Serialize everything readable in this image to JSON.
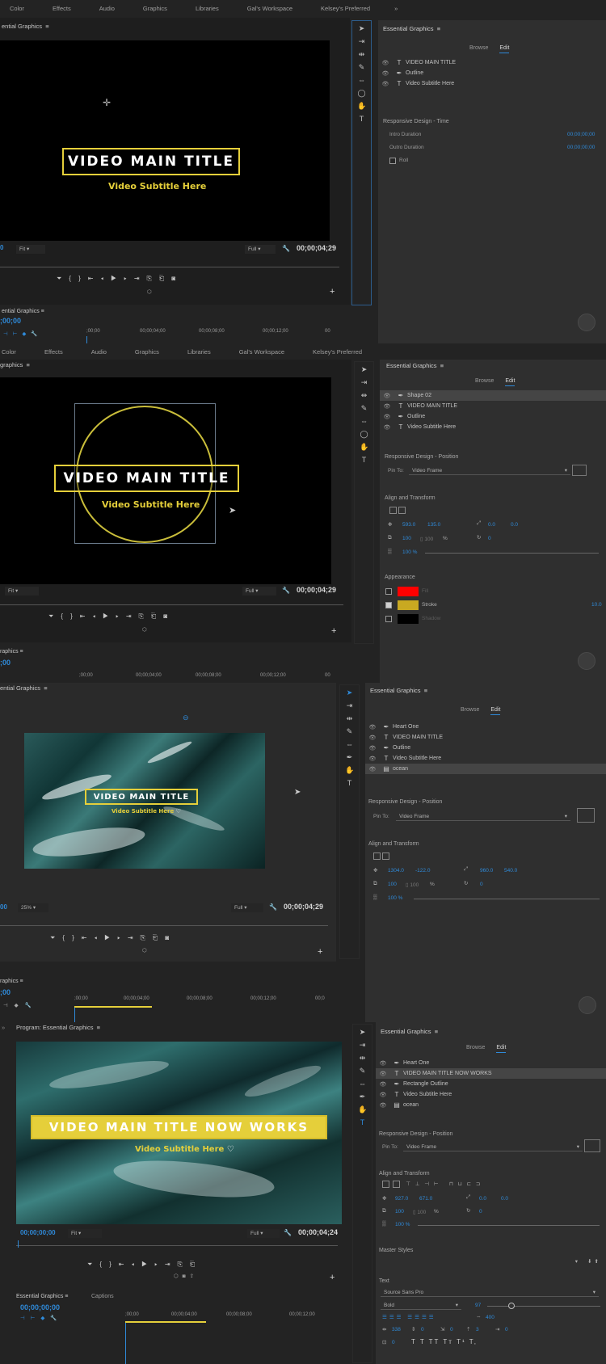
{
  "workspaces": [
    "Color",
    "Effects",
    "Audio",
    "Graphics",
    "Libraries",
    "Gal's Workspace",
    "Kelsey's Preferred"
  ],
  "overflow": "»",
  "s1": {
    "program_header": "ential Graphics",
    "title": "VIDEO MAIN TITLE",
    "subtitle": "Video Subtitle Here",
    "tc_left": "0",
    "fit": "Fit",
    "full": "Full",
    "timecode": "00;00;04;29",
    "tl_header": "ential Graphics",
    "tl_tc": ";00;00",
    "ruler": [
      ";00;00",
      "00;00;04;00",
      "00;00;08;00",
      "00;00;12;00",
      "00"
    ],
    "eg_title": "Essential Graphics",
    "browse": "Browse",
    "edit": "Edit",
    "layers": [
      "VIDEO MAIN TITLE",
      "Outline",
      "Video Subtitle Here"
    ],
    "rd_title": "Responsive Design - Time",
    "intro_label": "Intro Duration",
    "intro_val": "00;00;00;00",
    "outro_label": "Outro Duration",
    "outro_val": "00;00;00;00",
    "roll": "Roll"
  },
  "s2": {
    "program_header": "graphics",
    "title": "VIDEO MAIN TITLE",
    "subtitle": "Video Subtitle Here",
    "fit": "Fit",
    "full": "Full",
    "timecode": "00;00;04;29",
    "tl_header": "raphics",
    "tl_tc": ";00",
    "ruler": [
      ";00;00",
      "00;00;04;00",
      "00;00;08;00",
      "00;00;12;00",
      "00"
    ],
    "eg_title": "Essential Graphics",
    "browse": "Browse",
    "edit": "Edit",
    "layers": [
      "Shape 02",
      "VIDEO MAIN TITLE",
      "Outline",
      "Video Subtitle Here"
    ],
    "rd_title": "Responsive Design - Position",
    "pin_label": "Pin To:",
    "pin_val": "Video Frame",
    "at_title": "Align and Transform",
    "pos_x": "593.0",
    "pos_y": "135.0",
    "anchor_x": "0.0",
    "anchor_y": "0.0",
    "scale_a": "100",
    "scale_b": "100",
    "pct": "%",
    "rot": "0",
    "opacity": "100 %",
    "appearance": "Appearance",
    "fill": "Fill",
    "stroke": "Stroke",
    "stroke_val": "10.0",
    "shadow": "Shadow",
    "fill_color": "#ff0000",
    "stroke_color": "#c9a921",
    "shadow_color": "#000000"
  },
  "s3": {
    "program_header": "ential Graphics",
    "title": "VIDEO MAIN TITLE",
    "subtitle": "Video Subtitle Here",
    "tc_left": "00",
    "zoom": "25%",
    "full": "Full",
    "timecode": "00;00;04;29",
    "tl_header": "raphics",
    "tl_tc": ";00",
    "ruler": [
      ";00;00",
      "00;00;04;00",
      "00;00;08;00",
      "00;00;12;00",
      "00;0"
    ],
    "eg_title": "Essential Graphics",
    "browse": "Browse",
    "edit": "Edit",
    "layers": [
      "Heart One",
      "VIDEO MAIN TITLE",
      "Outline",
      "Video Subtitle Here",
      "ocean"
    ],
    "rd_title": "Responsive Design - Position",
    "pin_label": "Pin To:",
    "pin_val": "Video Frame",
    "at_title": "Align and Transform",
    "pos_x": "1304.0",
    "pos_y": "-122.0",
    "anchor_x": "960.0",
    "anchor_y": "540.0",
    "scale_a": "100",
    "scale_b": "100",
    "pct": "%",
    "rot": "0",
    "opacity": "100 %"
  },
  "s4": {
    "program_header": "Program: Essential Graphics",
    "title": "VIDEO MAIN TITLE NOW WORKS",
    "subtitle": "Video Subtitle Here",
    "tc_left": "00;00;00;00",
    "fit": "Fit",
    "full": "Full",
    "timecode": "00;00;04;24",
    "tl_tab1": "Essential Graphics",
    "tl_tab2": "Captions",
    "tl_tc": "00;00;00;00",
    "ruler": [
      ";00;00",
      "00;00;04;00",
      "00;00;08;00",
      "00;00;12;00"
    ],
    "eg_title": "Essential Graphics",
    "browse": "Browse",
    "edit": "Edit",
    "layers": [
      "Heart One",
      "VIDEO MAIN TITLE NOW WORKS",
      "Rectangle Outline",
      "Video Subtitle Here",
      "ocean"
    ],
    "rd_title": "Responsive Design - Position",
    "pin_label": "Pin To:",
    "pin_val": "Video Frame",
    "at_title": "Align and Transform",
    "pos_x": "927.0",
    "pos_y": "671.0",
    "anchor_x": "0.0",
    "anchor_y": "0.0",
    "scale_a": "100",
    "scale_b": "100",
    "pct": "%",
    "rot": "0",
    "opacity": "100 %",
    "master": "Master Styles",
    "text": "Text",
    "font": "Source Sans Pro",
    "style": "Bold",
    "size": "97",
    "tracking": "400",
    "kern": "338",
    "lead": "0",
    "tsume": "0",
    "baseline": "3",
    "tab": "0",
    "other": "0",
    "styles_row": "T T TT Tт T¹ T,"
  }
}
